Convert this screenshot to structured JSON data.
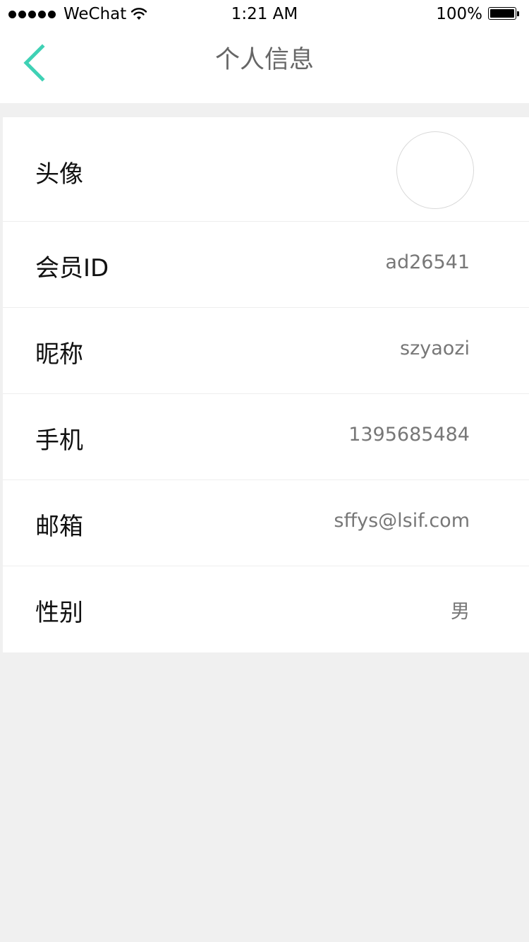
{
  "status_bar": {
    "carrier": "WeChat",
    "time": "1:21 AM",
    "battery": "100%"
  },
  "nav": {
    "title": "个人信息",
    "back_icon": "chevron-left-icon",
    "accent_color": "#3fd1b5"
  },
  "profile": {
    "avatar_label": "头像",
    "rows": [
      {
        "label": "会员ID",
        "value": "ad26541"
      },
      {
        "label": "昵称",
        "value": "szyaozi"
      },
      {
        "label": "手机",
        "value": "1395685484"
      },
      {
        "label": "邮箱",
        "value": "sffys@lsif.com"
      },
      {
        "label": "性别",
        "value": "男"
      }
    ]
  }
}
